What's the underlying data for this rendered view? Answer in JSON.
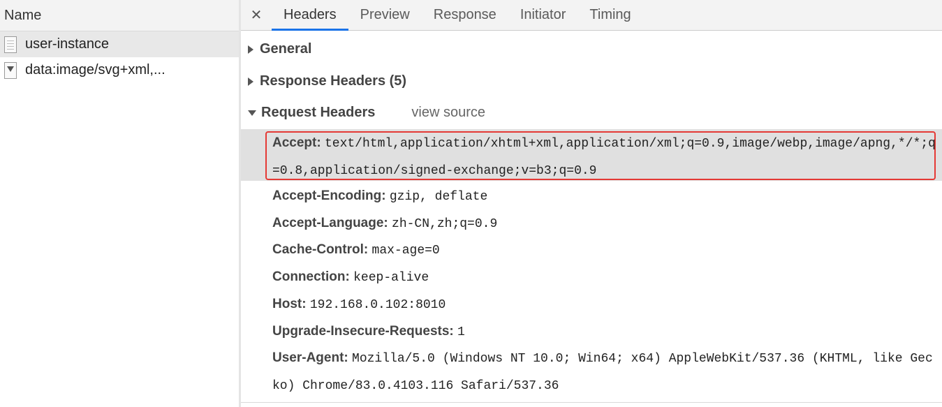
{
  "left_panel": {
    "column_header": "Name",
    "requests": [
      {
        "name": "user-instance",
        "icon": "document-icon",
        "selected": true
      },
      {
        "name": "data:image/svg+xml,...",
        "icon": "svg-file-icon",
        "selected": false
      }
    ]
  },
  "tabs": {
    "close_symbol": "✕",
    "items": [
      "Headers",
      "Preview",
      "Response",
      "Initiator",
      "Timing"
    ],
    "active": "Headers"
  },
  "sections": {
    "general": "General",
    "response_headers": "Response Headers (5)",
    "request_headers": "Request Headers",
    "view_source": "view source"
  },
  "request_headers": [
    {
      "key": "Accept:",
      "value": "text/html,application/xhtml+xml,application/xml;q=0.9,image/webp,image/apng,*/*;q=0.8,application/signed-exchange;v=b3;q=0.9"
    },
    {
      "key": "Accept-Encoding:",
      "value": "gzip, deflate"
    },
    {
      "key": "Accept-Language:",
      "value": "zh-CN,zh;q=0.9"
    },
    {
      "key": "Cache-Control:",
      "value": "max-age=0"
    },
    {
      "key": "Connection:",
      "value": "keep-alive"
    },
    {
      "key": "Host:",
      "value": "192.168.0.102:8010"
    },
    {
      "key": "Upgrade-Insecure-Requests:",
      "value": "1"
    },
    {
      "key": "User-Agent:",
      "value": "Mozilla/5.0 (Windows NT 10.0; Win64; x64) AppleWebKit/537.36 (KHTML, like Gecko) Chrome/83.0.4103.116 Safari/537.36"
    }
  ],
  "colors": {
    "active_tab_underline": "#1a73e8",
    "highlight_border": "#e53935",
    "selected_row": "#e0e0e0"
  }
}
